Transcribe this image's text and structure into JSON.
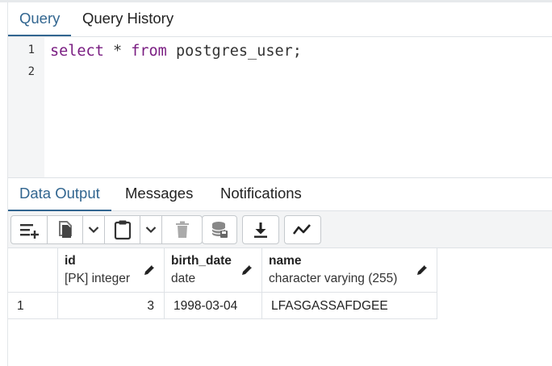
{
  "query_tabs": [
    "Query",
    "Query History"
  ],
  "editor": {
    "line_numbers": [
      "1",
      "2"
    ],
    "keyword_select": "select",
    "star": " * ",
    "keyword_from": "from",
    "rest": " postgres_user;"
  },
  "output_tabs": [
    "Data Output",
    "Messages",
    "Notifications"
  ],
  "toolbar_icons": [
    "add-row-icon",
    "copy-icon",
    "chevron-down-icon",
    "paste-icon",
    "chevron-down-icon",
    "delete-icon",
    "save-data-icon",
    "download-icon",
    "graph-visualiser-icon"
  ],
  "grid": {
    "columns": [
      {
        "name": "id",
        "type": "[PK] integer"
      },
      {
        "name": "birth_date",
        "type": "date"
      },
      {
        "name": "name",
        "type": "character varying (255)"
      }
    ],
    "rows": [
      {
        "row_number": "1",
        "cells": [
          "3",
          "1998-03-04",
          "LFASGASSAFDGEE"
        ]
      }
    ]
  },
  "colors": {
    "accent": "#326690",
    "keyword": "#7a1e82"
  }
}
